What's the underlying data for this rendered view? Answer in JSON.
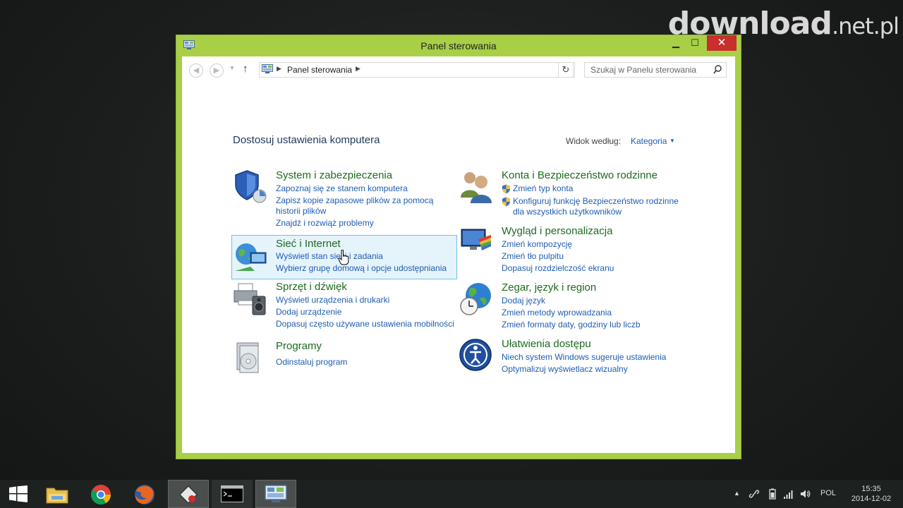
{
  "watermark": {
    "brand": "download",
    "domain": ".net.pl"
  },
  "window": {
    "title": "Panel sterowania",
    "controls": {
      "minimize": "▁",
      "maximize": "☐",
      "close": "✕"
    }
  },
  "address": {
    "path": "Panel sterowania",
    "search_placeholder": "Szukaj w Panelu sterowania"
  },
  "main": {
    "heading": "Dostosuj ustawienia komputera",
    "view_by_label": "Widok według:",
    "view_by_value": "Kategoria"
  },
  "categories": {
    "system": {
      "title": "System i zabezpieczenia",
      "links": [
        "Zapoznaj się ze stanem komputera",
        "Zapisz kopie zapasowe plików za pomocą",
        "historii plików",
        "Znajdź i rozwiąż problemy"
      ]
    },
    "accounts": {
      "title": "Konta i Bezpieczeństwo rodzinne",
      "links": [
        "Zmień typ konta",
        "Konfiguruj funkcję Bezpieczeństwo rodzinne",
        "dla wszystkich użytkowników"
      ]
    },
    "network": {
      "title": "Sieć i Internet",
      "links": [
        "Wyświetl stan sieci i zadania",
        "Wybierz grupę domową i opcje udostępniania"
      ]
    },
    "appearance": {
      "title": "Wygląd i personalizacja",
      "links": [
        "Zmień kompozycję",
        "Zmień tło pulpitu",
        "Dopasuj rozdzielczość ekranu"
      ]
    },
    "hardware": {
      "title": "Sprzęt i dźwięk",
      "links": [
        "Wyświetl urządzenia i drukarki",
        "Dodaj urządzenie",
        "Dopasuj często używane ustawienia mobilności"
      ]
    },
    "clock": {
      "title": "Zegar, język i region",
      "links": [
        "Dodaj język",
        "Zmień metody wprowadzania",
        "Zmień formaty daty, godziny lub liczb"
      ]
    },
    "programs": {
      "title": "Programy",
      "links": [
        "Odinstaluj program"
      ]
    },
    "ease": {
      "title": "Ułatwienia dostępu",
      "links": [
        "Niech system Windows sugeruje ustawienia",
        "Optymalizuj wyświetlacz wizualny"
      ]
    }
  },
  "taskbar": {
    "items": [
      "start-button",
      "file-explorer-icon",
      "chrome-icon",
      "firefox-icon",
      "app-icon",
      "command-prompt-icon",
      "control-panel-icon"
    ],
    "language": "POL",
    "time": "15:35",
    "date": "2014-12-02"
  },
  "colors": {
    "window_frame": "#a9cf47",
    "category_title": "#1e6b1e",
    "link": "#1e5db3",
    "close_button": "#c7302b"
  }
}
